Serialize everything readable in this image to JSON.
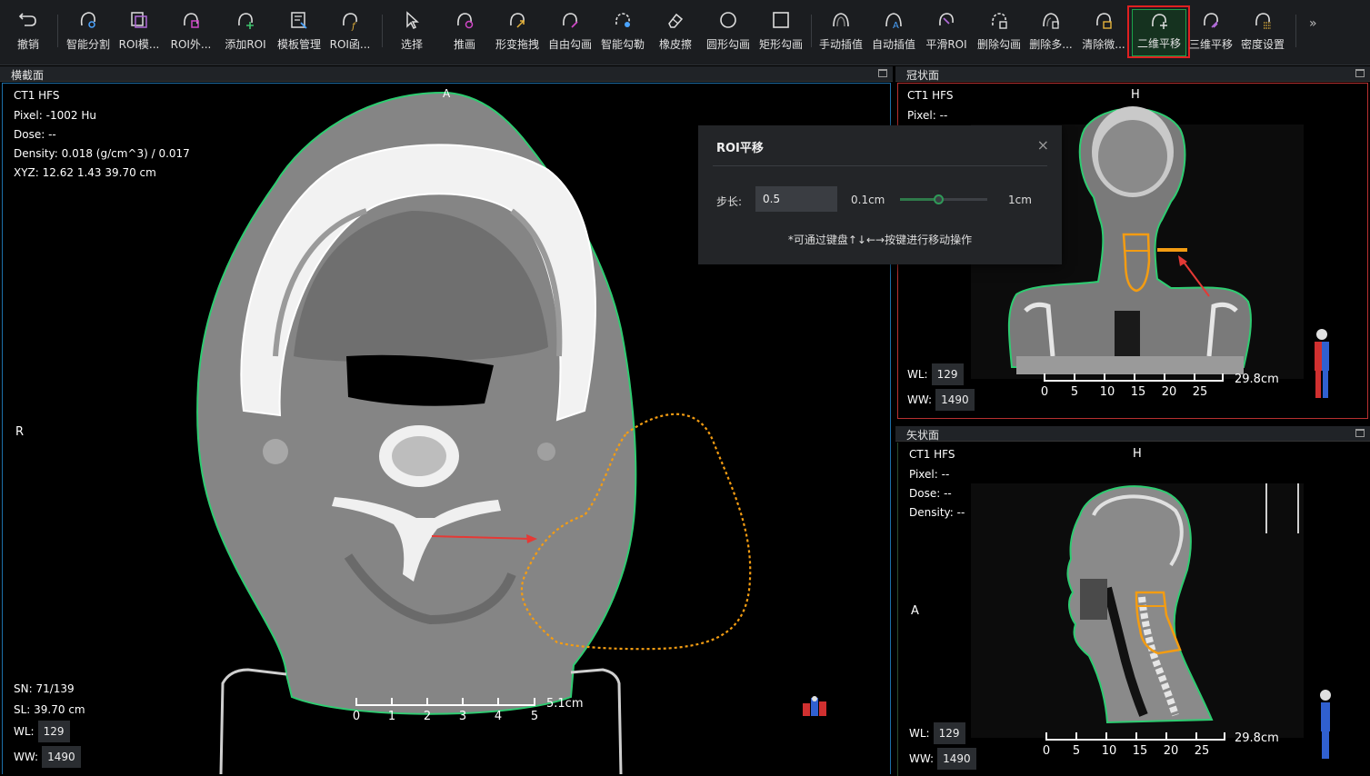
{
  "toolbar": {
    "undo": "撤销",
    "smart_seg": "智能分割",
    "roi_model": "ROI模...",
    "roi_ext": "ROI外...",
    "add_roi": "添加ROI",
    "template_mgmt": "模板管理",
    "roi_func": "ROI函...",
    "select": "选择",
    "push": "推画",
    "deform_drag": "形变拖拽",
    "free_draw": "自由勾画",
    "smart_draw": "智能勾勒",
    "eraser": "橡皮擦",
    "circle_draw": "圆形勾画",
    "rect_draw": "矩形勾画",
    "manual_interp": "手动插值",
    "auto_interp": "自动插值",
    "smooth_roi": "平滑ROI",
    "delete_draw": "删除勾画",
    "delete_multi": "删除多...",
    "clear_micro": "清除微...",
    "pan_2d": "二维平移",
    "pan_3d": "三维平移",
    "density_set": "密度设置",
    "more": "»"
  },
  "axial": {
    "title": "横截面",
    "series": "CT1 HFS",
    "pixel_label": "Pixel:",
    "pixel_value": "-1002 Hu",
    "dose_label": "Dose:",
    "dose_value": "--",
    "density_label": "Density:",
    "density_value": "0.018 (g/cm^3) / 0.017",
    "xyz_label": "XYZ:",
    "xyz_value": "12.62 1.43 39.70 cm",
    "orient_top": "A",
    "orient_left": "R",
    "sn": "SN: 71/139",
    "sl": "SL: 39.70 cm",
    "wl_label": "WL:",
    "wl_value": "129",
    "ww_label": "WW:",
    "ww_value": "1490",
    "scale_label": "5.1cm",
    "scale_ticks": [
      "0",
      "1",
      "2",
      "3",
      "4",
      "5"
    ]
  },
  "coronal": {
    "title": "冠状面",
    "series": "CT1 HFS",
    "pixel_label": "Pixel:",
    "pixel_value": "--",
    "orient_top": "H",
    "wl_label": "WL:",
    "wl_value": "129",
    "ww_label": "WW:",
    "ww_value": "1490",
    "scale_label": "29.8cm",
    "scale_ticks": [
      "0",
      "5",
      "10",
      "15",
      "20",
      "25"
    ]
  },
  "sagittal": {
    "title": "矢状面",
    "series": "CT1 HFS",
    "pixel_label": "Pixel:",
    "pixel_value": "--",
    "dose_label": "Dose:",
    "dose_value": "--",
    "density_label": "Density:",
    "density_value": "--",
    "orient_top": "H",
    "orient_left": "A",
    "wl_label": "WL:",
    "wl_value": "129",
    "ww_label": "WW:",
    "ww_value": "1490",
    "scale_label": "29.8cm",
    "scale_ticks": [
      "0",
      "5",
      "10",
      "15",
      "20",
      "25"
    ]
  },
  "dialog": {
    "title": "ROI平移",
    "close": "×",
    "step_label": "步长:",
    "step_value": "0.5",
    "min_label": "0.1cm",
    "max_label": "1cm",
    "slider_fraction": 0.44,
    "hint": "*可通过键盘↑↓←→按键进行移动操作"
  },
  "colors": {
    "roi_body": "#2ecc71",
    "roi_target": "#f39c12",
    "annotation_arrow": "#e53935",
    "active_tool": "#19a34a"
  }
}
